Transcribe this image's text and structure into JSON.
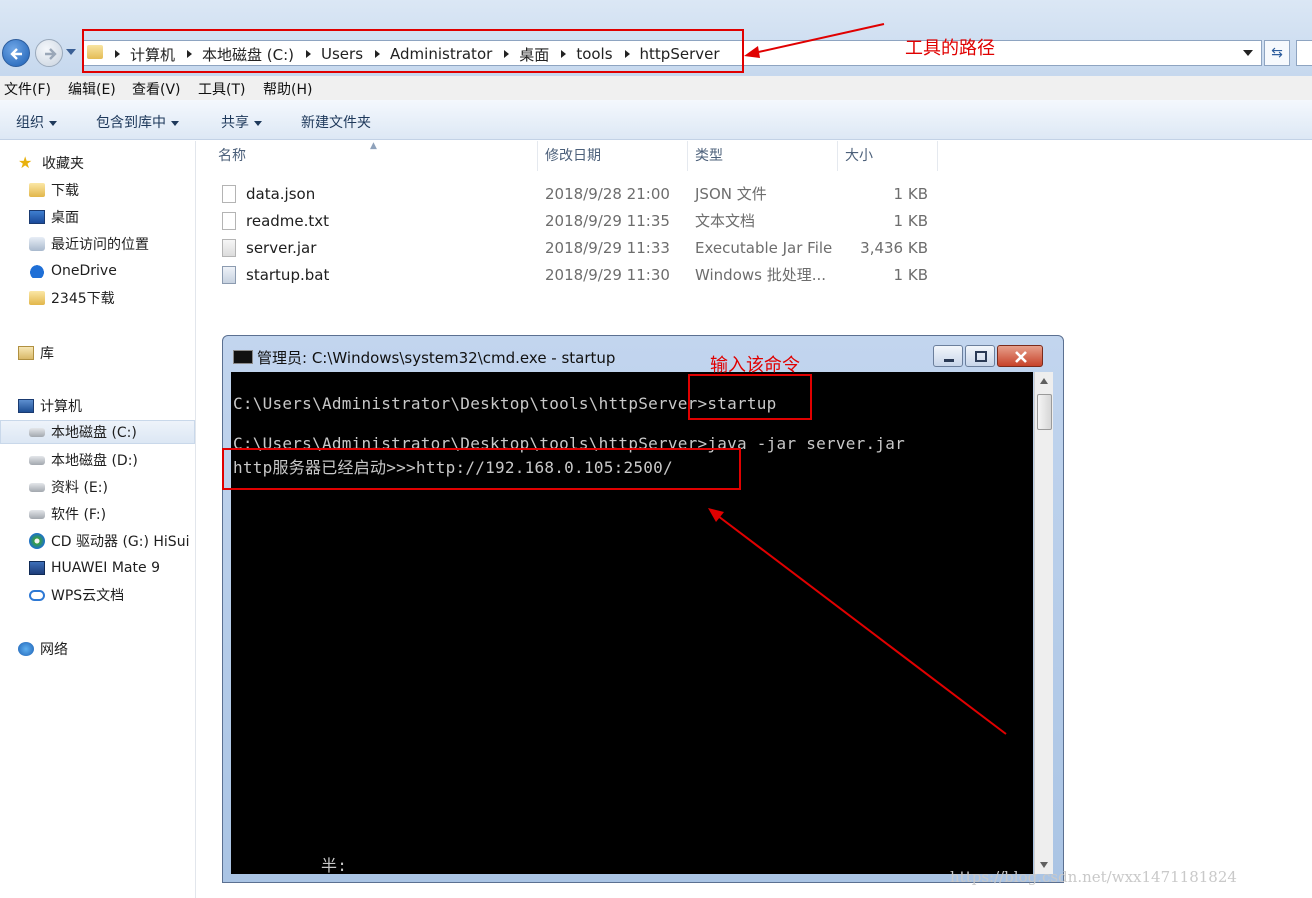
{
  "address_bar": {
    "breadcrumbs": [
      "计算机",
      "本地磁盘 (C:)",
      "Users",
      "Administrator",
      "桌面",
      "tools",
      "httpServer"
    ]
  },
  "menu": [
    "文件(F)",
    "编辑(E)",
    "查看(V)",
    "工具(T)",
    "帮助(H)"
  ],
  "toolbar": {
    "organize": "组织",
    "include_library": "包含到库中",
    "share": "共享",
    "new_folder": "新建文件夹"
  },
  "sidebar": {
    "favorites": {
      "header": "收藏夹",
      "items": [
        "下载",
        "桌面",
        "最近访问的位置",
        "OneDrive",
        "2345下载"
      ]
    },
    "libraries": "库",
    "computer": {
      "header": "计算机",
      "items": [
        "本地磁盘 (C:)",
        "本地磁盘 (D:)",
        "资料 (E:)",
        "软件 (F:)",
        "CD 驱动器 (G:) HiSui",
        "HUAWEI Mate 9",
        "WPS云文档"
      ]
    },
    "network": "网络"
  },
  "columns": [
    "名称",
    "修改日期",
    "类型",
    "大小"
  ],
  "files": [
    {
      "name": "data.json",
      "date": "2018/9/28 21:00",
      "type": "JSON 文件",
      "size": "1 KB"
    },
    {
      "name": "readme.txt",
      "date": "2018/9/29 11:35",
      "type": "文本文档",
      "size": "1 KB"
    },
    {
      "name": "server.jar",
      "date": "2018/9/29 11:33",
      "type": "Executable Jar File",
      "size": "3,436 KB"
    },
    {
      "name": "startup.bat",
      "date": "2018/9/29 11:30",
      "type": "Windows 批处理...",
      "size": "1 KB"
    }
  ],
  "cmd": {
    "title": "管理员: C:\\Windows\\system32\\cmd.exe - startup",
    "lines": [
      "C:\\Users\\Administrator\\Desktop\\tools\\httpServer>startup",
      "C:\\Users\\Administrator\\Desktop\\tools\\httpServer>java -jar server.jar",
      "http服务器已经启动>>>http://192.168.0.105:2500/"
    ],
    "ime_status": "半:"
  },
  "annotations": {
    "path_label": "工具的路径",
    "command_label": "输入该命令"
  },
  "watermark": "https://blog.csdn.net/wxx1471181824",
  "colors": {
    "annotation_red": "#e00000",
    "console_bg": "#000000",
    "console_text": "#c8c8c8"
  }
}
